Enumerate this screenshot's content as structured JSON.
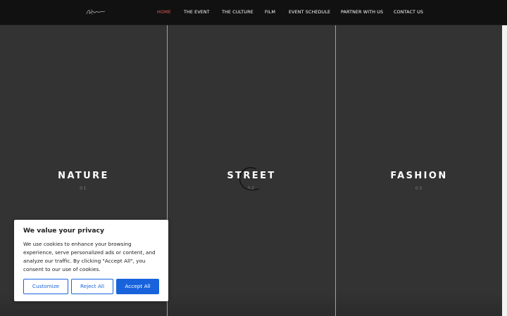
{
  "nav": {
    "items": [
      {
        "label": "HOME",
        "active": true
      },
      {
        "label": "THE EVENT",
        "active": false
      },
      {
        "label": "THE CULTURE",
        "active": false
      },
      {
        "label": "FILM",
        "active": false
      },
      {
        "label": "EVENT SCHEDULE",
        "active": false
      },
      {
        "label": "PARTNER WITH US",
        "active": false
      },
      {
        "label": "CONTACT US",
        "active": false
      }
    ]
  },
  "panels": [
    {
      "title": "NATURE",
      "number": "01"
    },
    {
      "title": "STREET",
      "number": "02"
    },
    {
      "title": "FASHION",
      "number": "03"
    }
  ],
  "cookie": {
    "title": "We value your privacy",
    "text": "We use cookies to enhance your browsing experience, serve personalized ads or content, and analyze our traffic. By clicking \"Accept All\", you consent to our use of cookies.",
    "customize_label": "Customize",
    "reject_label": "Reject All",
    "accept_label": "Accept All"
  },
  "colors": {
    "accent_nav_active": "#e45d55",
    "accept_button": "#1863dc"
  }
}
